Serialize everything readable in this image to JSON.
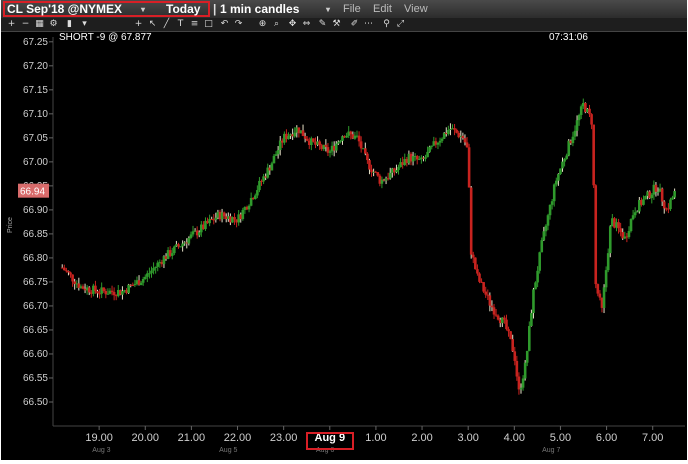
{
  "titlebar": {
    "symbol": "CL Sep'18 @NYMEX",
    "period": "Today",
    "interval": "1 min candles",
    "menu": [
      "File",
      "Edit",
      "View"
    ]
  },
  "toolbar": {
    "icons": [
      "zoom-in-icon",
      "zoom-out-icon",
      "grid-icon",
      "settings-icon",
      "chart-type-icon",
      "dropdown-icon",
      "crosshair-icon",
      "arrow-icon",
      "line-tool-icon",
      "text-tool-icon",
      "fib-tool-icon",
      "shape-tool-icon",
      "undo-icon",
      "redo-icon",
      "zoom-icon",
      "search-icon",
      "pan-icon",
      "measure-icon",
      "drawing-icon",
      "tools-icon",
      "brush-icon",
      "more-icon",
      "pin-icon",
      "expand-icon"
    ]
  },
  "position": {
    "label": "SHORT -9 @ 67.877"
  },
  "clock": "07:31:06",
  "y_axis": {
    "label": "Price",
    "current_price": "66.94"
  },
  "colors": {
    "up": "#2f9a2c",
    "down": "#c8231f",
    "highlight": "#d81f26",
    "background": "#000000",
    "price_badge": "#d86b6b"
  },
  "chart_data": {
    "type": "candlestick",
    "ylabel": "Price",
    "ylim": [
      66.45,
      67.26
    ],
    "yticks": [
      "67.25",
      "67.20",
      "67.15",
      "67.10",
      "67.05",
      "67.00",
      "66.95",
      "66.90",
      "66.85",
      "66.80",
      "66.75",
      "66.70",
      "66.65",
      "66.60",
      "66.55",
      "66.50"
    ],
    "xticks": [
      "19.00",
      "20.00",
      "21.00",
      "22.00",
      "23.00",
      "Aug 9",
      "1.00",
      "2.00",
      "3.00",
      "4.00",
      "5.00",
      "6.00",
      "7.00"
    ],
    "date_labels": [
      "Aug 3",
      "Aug 5",
      "Aug 6",
      "Aug 7"
    ],
    "close_path": [
      [
        18.2,
        66.78
      ],
      [
        18.6,
        66.74
      ],
      [
        19.0,
        66.73
      ],
      [
        19.5,
        66.73
      ],
      [
        20.0,
        66.76
      ],
      [
        20.4,
        66.8
      ],
      [
        20.8,
        66.83
      ],
      [
        21.2,
        66.86
      ],
      [
        21.6,
        66.89
      ],
      [
        22.0,
        66.88
      ],
      [
        22.4,
        66.94
      ],
      [
        22.7,
        66.99
      ],
      [
        23.0,
        67.05
      ],
      [
        23.3,
        67.07
      ],
      [
        23.6,
        67.04
      ],
      [
        24.0,
        67.02
      ],
      [
        24.3,
        67.06
      ],
      [
        24.6,
        67.05
      ],
      [
        24.8,
        67.0
      ],
      [
        25.1,
        66.96
      ],
      [
        25.4,
        66.98
      ],
      [
        25.7,
        67.01
      ],
      [
        26.0,
        67.0
      ],
      [
        26.3,
        67.04
      ],
      [
        26.6,
        67.07
      ],
      [
        26.9,
        67.05
      ],
      [
        27.0,
        67.02
      ],
      [
        27.05,
        66.82
      ],
      [
        27.2,
        66.76
      ],
      [
        27.5,
        66.7
      ],
      [
        27.8,
        66.66
      ],
      [
        28.0,
        66.6
      ],
      [
        28.1,
        66.52
      ],
      [
        28.25,
        66.58
      ],
      [
        28.4,
        66.72
      ],
      [
        28.6,
        66.83
      ],
      [
        28.9,
        66.96
      ],
      [
        29.2,
        67.04
      ],
      [
        29.5,
        67.12
      ],
      [
        29.7,
        67.08
      ],
      [
        29.75,
        66.75
      ],
      [
        29.9,
        66.69
      ],
      [
        30.1,
        66.88
      ],
      [
        30.4,
        66.84
      ],
      [
        30.6,
        66.9
      ],
      [
        30.9,
        66.93
      ],
      [
        31.1,
        66.95
      ],
      [
        31.3,
        66.9
      ],
      [
        31.5,
        66.94
      ]
    ]
  }
}
